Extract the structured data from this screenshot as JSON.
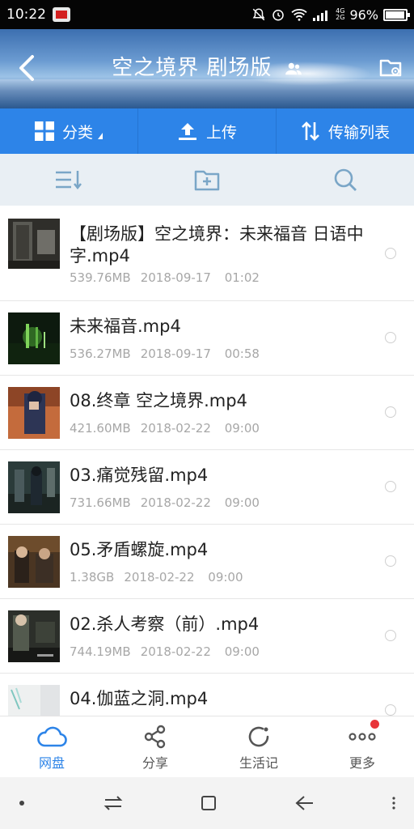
{
  "status_bar": {
    "time": "10:22",
    "network_top": "4G",
    "network_bottom": "2G",
    "battery": "96%",
    "battery_level": 0.96
  },
  "header": {
    "title": "空之境界 剧场版"
  },
  "toolbar": {
    "category_label": "分类",
    "upload_label": "上传",
    "transfer_label": "传输列表"
  },
  "files": [
    {
      "name": "【剧场版】空之境界：未来福音 日语中字.mp4",
      "size": "539.76MB",
      "date": "2018-09-17",
      "time": "01:02"
    },
    {
      "name": "未来福音.mp4",
      "size": "536.27MB",
      "date": "2018-09-17",
      "time": "00:58"
    },
    {
      "name": "08.终章 空之境界.mp4",
      "size": "421.60MB",
      "date": "2018-02-22",
      "time": "09:00"
    },
    {
      "name": "03.痛觉残留.mp4",
      "size": "731.66MB",
      "date": "2018-02-22",
      "time": "09:00"
    },
    {
      "name": "05.矛盾螺旋.mp4",
      "size": "1.38GB",
      "date": "2018-02-22",
      "time": "09:00"
    },
    {
      "name": "02.杀人考察（前）.mp4",
      "size": "744.19MB",
      "date": "2018-02-22",
      "time": "09:00"
    },
    {
      "name": "04.伽蓝之洞.mp4",
      "size": "",
      "date": "",
      "time": ""
    }
  ],
  "bottom_nav": {
    "cloud": "网盘",
    "share": "分享",
    "life": "生活记",
    "more": "更多"
  },
  "colors": {
    "accent": "#2d84e8",
    "badge": "#e8353a"
  }
}
